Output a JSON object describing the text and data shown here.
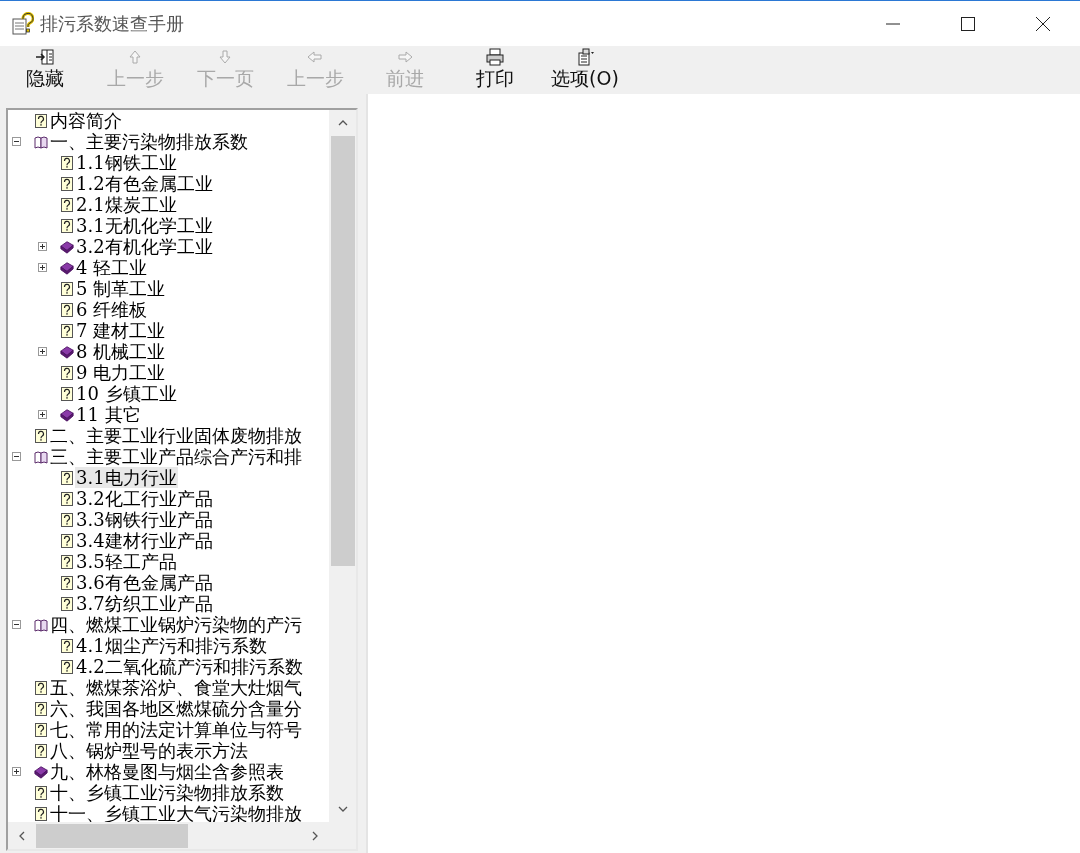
{
  "window": {
    "title": "排污系数速查手册"
  },
  "toolbar": [
    {
      "label": "隐藏",
      "disabled": false
    },
    {
      "label": "上一步",
      "disabled": true
    },
    {
      "label": "下一页",
      "disabled": true
    },
    {
      "label": "上一步",
      "disabled": true
    },
    {
      "label": "前进",
      "disabled": true
    },
    {
      "label": "打印",
      "disabled": false
    },
    {
      "label": "选项(O)",
      "disabled": false
    }
  ],
  "tree": [
    {
      "kind": "page",
      "label": "内容简介",
      "selected": false
    },
    {
      "kind": "book",
      "label": "一、主要污染物排放系数",
      "expanded": true,
      "selected": false,
      "children": [
        {
          "kind": "page",
          "label": "1.1钢铁工业",
          "selected": false
        },
        {
          "kind": "page",
          "label": "1.2有色金属工业",
          "selected": false
        },
        {
          "kind": "page",
          "label": "2.1煤炭工业",
          "selected": false
        },
        {
          "kind": "page",
          "label": "3.1无机化学工业",
          "selected": false
        },
        {
          "kind": "book",
          "label": "3.2有机化学工业",
          "expanded": false,
          "selected": false
        },
        {
          "kind": "book",
          "label": "4 轻工业",
          "expanded": false,
          "selected": false
        },
        {
          "kind": "page",
          "label": "5 制革工业",
          "selected": false
        },
        {
          "kind": "page",
          "label": "6 纤维板",
          "selected": false
        },
        {
          "kind": "page",
          "label": "7 建材工业",
          "selected": false
        },
        {
          "kind": "book",
          "label": "8 机械工业",
          "expanded": false,
          "selected": false
        },
        {
          "kind": "page",
          "label": "9 电力工业",
          "selected": false
        },
        {
          "kind": "page",
          "label": "10 乡镇工业",
          "selected": false
        },
        {
          "kind": "book",
          "label": "11 其它",
          "expanded": false,
          "selected": false
        }
      ]
    },
    {
      "kind": "page",
      "label": "二、主要工业行业固体废物排放",
      "selected": false
    },
    {
      "kind": "book",
      "label": "三、主要工业产品综合产污和排",
      "expanded": true,
      "selected": false,
      "children": [
        {
          "kind": "page",
          "label": "3.1电力行业",
          "selected": true
        },
        {
          "kind": "page",
          "label": "3.2化工行业产品",
          "selected": false
        },
        {
          "kind": "page",
          "label": "3.3钢铁行业产品",
          "selected": false
        },
        {
          "kind": "page",
          "label": "3.4建材行业产品",
          "selected": false
        },
        {
          "kind": "page",
          "label": "3.5轻工产品",
          "selected": false
        },
        {
          "kind": "page",
          "label": "3.6有色金属产品",
          "selected": false
        },
        {
          "kind": "page",
          "label": "3.7纺织工业产品",
          "selected": false
        }
      ]
    },
    {
      "kind": "book",
      "label": "四、燃煤工业锅炉污染物的产污",
      "expanded": true,
      "selected": false,
      "children": [
        {
          "kind": "page",
          "label": "4.1烟尘产污和排污系数",
          "selected": false
        },
        {
          "kind": "page",
          "label": "4.2二氧化硫产污和排污系数",
          "selected": false
        }
      ]
    },
    {
      "kind": "page",
      "label": "五、燃煤茶浴炉、食堂大灶烟气",
      "selected": false
    },
    {
      "kind": "page",
      "label": "六、我国各地区燃煤硫分含量分",
      "selected": false
    },
    {
      "kind": "page",
      "label": "七、常用的法定计算单位与符号",
      "selected": false
    },
    {
      "kind": "page",
      "label": "八、锅炉型号的表示方法",
      "selected": false
    },
    {
      "kind": "book",
      "label": "九、林格曼图与烟尘含参照表",
      "expanded": false,
      "selected": false
    },
    {
      "kind": "page",
      "label": "十、乡镇工业污染物排放系数",
      "selected": false
    },
    {
      "kind": "page",
      "label": "十一、乡镇工业大气污染物排放",
      "selected": false
    }
  ]
}
